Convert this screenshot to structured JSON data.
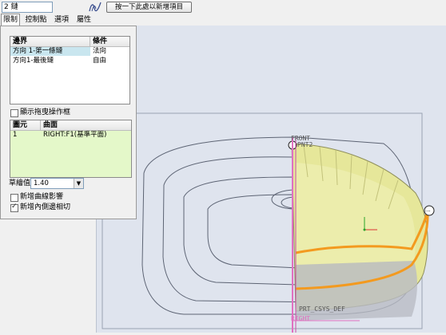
{
  "toolbar": {
    "chain_value": "2 鏈",
    "curve_icon": "curve-chain-icon",
    "click_here_label": "按一下此處以新增項目"
  },
  "tabs": [
    {
      "label": "限制"
    },
    {
      "label": "控制點"
    },
    {
      "label": "選項"
    },
    {
      "label": "屬性"
    }
  ],
  "boundary_table": {
    "headers": [
      "邊界",
      "條件"
    ],
    "rows": [
      {
        "boundary": "方向 1-第一條鏈",
        "condition": "法向"
      },
      {
        "boundary": "方向1-最後鏈",
        "condition": "自由"
      }
    ]
  },
  "show_drag_handles": {
    "label": "顯示拖曳操作框",
    "checked": false
  },
  "surface_table": {
    "headers": [
      "圖元",
      "曲面"
    ],
    "rows": [
      {
        "entity": "1",
        "surface": "RIGHT:F1(基準平面)"
      }
    ]
  },
  "tension": {
    "label": "草繪值",
    "value": "1.40"
  },
  "add_side_curve_influence": {
    "label": "新增曲線影響",
    "checked": false
  },
  "add_inner_edge_tangent": {
    "label": "新增內側邊相切",
    "checked": true
  },
  "viewport": {
    "label_front": "FRONT",
    "label_pnt": "PNT2",
    "label_csys": "PRT_CSYS_DEF",
    "label_right": "RIGHT",
    "colors": {
      "surface": "#e6e79a",
      "curve": "#f39a1f",
      "datum": "#e070c0",
      "background": "#dfe4ee"
    }
  }
}
